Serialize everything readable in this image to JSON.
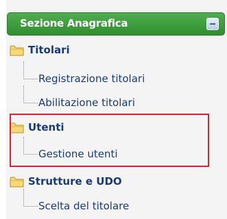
{
  "header": {
    "title": "Sezione Anagrafica"
  },
  "groups": [
    {
      "label": "Titolari",
      "items": [
        "Registrazione titolari",
        "Abilitazione titolari"
      ]
    },
    {
      "label": "Utenti",
      "items": [
        "Gestione utenti"
      ]
    },
    {
      "label": "Strutture e UDO",
      "items": [
        "Scelta del titolare"
      ]
    }
  ],
  "colors": {
    "header_green": "#3a9a3a",
    "link_blue": "#1a3a7a",
    "highlight_red": "#e0212e"
  }
}
